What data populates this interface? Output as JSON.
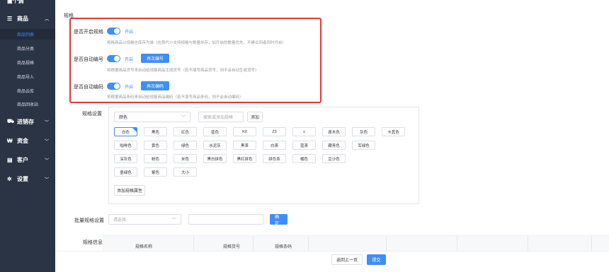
{
  "sidebar": {
    "top_label": "个调",
    "groups": [
      {
        "label": "商品",
        "icon": "list-icon"
      },
      {
        "label": "进销存",
        "icon": "truck-icon"
      },
      {
        "label": "资金",
        "icon": "yen-icon"
      },
      {
        "label": "客户",
        "icon": "id-card-icon"
      },
      {
        "label": "设置",
        "icon": "gear-icon"
      }
    ],
    "items": [
      "商品列表",
      "商品分类",
      "商品规格",
      "商品导入",
      "商品云库",
      "商品回收站"
    ]
  },
  "main": {
    "section_title": "规格",
    "rows": [
      {
        "label": "是否开启规格",
        "state": "开启",
        "hint": "规格商品以规格也库存为准（在那代小支持规格与数量并存，如开启的数量优先，不建议同者同时开启）"
      },
      {
        "label": "是否自动编号",
        "state": "开启",
        "button": "再次编号",
        "hint": "将根据商品货号来自动给规格商品生成货号（若不填写商品货号，则不会自动生成货号）"
      },
      {
        "label": "是否自动编码",
        "state": "开启",
        "button": "再次编码",
        "hint": "将根据商品条码来自动给规格商品编码（若不填写商品条码，则不会自动编码）"
      }
    ],
    "spec_settings": {
      "label": "规格设置",
      "select_value": "颜色",
      "search_placeholder": "搜索或添加规格",
      "add_label": "添加",
      "chips": [
        "白色",
        "黑色",
        "红色",
        "蓝色",
        "KII",
        "Z3",
        "s",
        "原木色",
        "灰色",
        "卡其色",
        "咖啡色",
        "黄色",
        "绿色",
        "水泥灰",
        "黑茶",
        "白茶",
        "蓝茶",
        "藏青色",
        "军绿色",
        "深灰色",
        "粉色",
        "米色",
        "黑白拼色",
        "黑红拼色",
        "拼色系",
        "橘色",
        "豆沙色",
        "墨绿色",
        "紫色",
        "大小"
      ],
      "add_attr_label": "添加规格属性"
    },
    "batch": {
      "label": "批量规格设置",
      "select_placeholder": "请选择",
      "confirm_label": "确定"
    },
    "spec_info": {
      "label": "规格信息",
      "columns": [
        "规格名称",
        "规格货号",
        "规格条码"
      ]
    },
    "footer": {
      "back_label": "返回上一页",
      "submit_label": "提交"
    }
  }
}
